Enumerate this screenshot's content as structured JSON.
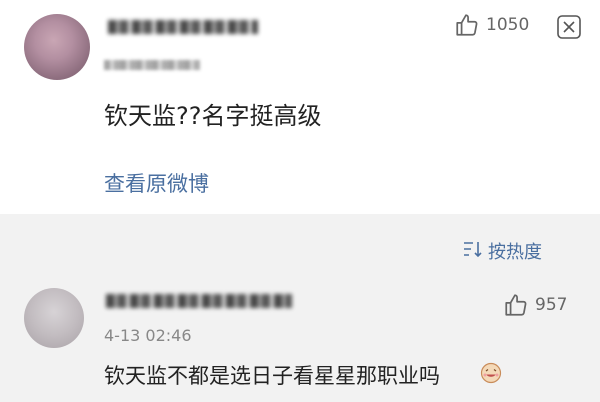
{
  "comment1": {
    "likes": "1050",
    "text": "钦天监??名字挺高级",
    "view_original": "查看原微博"
  },
  "sort": {
    "label": "按热度",
    "icon": "sort-icon"
  },
  "comment2": {
    "likes": "957",
    "time": "4-13 02:46",
    "text": "钦天监不都是选日子看星星那职业吗"
  },
  "icons": {
    "like": "thumbs-up-icon",
    "close": "close-icon",
    "emoji": "laughing-emoji-icon"
  },
  "colors": {
    "link": "#4a6fa0",
    "background": "#f2f2f2",
    "card": "#ffffff"
  }
}
